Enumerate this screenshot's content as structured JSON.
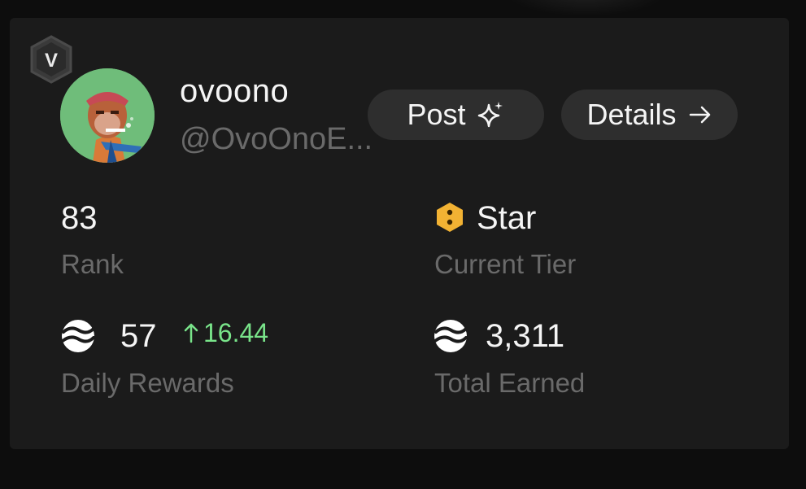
{
  "profile": {
    "badge_letter": "V",
    "username": "ovoono",
    "handle": "@OvoOnoE..."
  },
  "actions": {
    "post_label": "Post",
    "details_label": "Details"
  },
  "stats": {
    "rank": {
      "value": "83",
      "label": "Rank"
    },
    "tier": {
      "value": "Star",
      "label": "Current Tier"
    },
    "daily": {
      "value": "57",
      "delta": "16.44",
      "label": "Daily Rewards"
    },
    "total": {
      "value": "3,311",
      "label": "Total Earned"
    }
  },
  "icons": {
    "badge": "verified-v-hexagon-icon",
    "post": "sparkles-icon",
    "details": "arrow-right-icon",
    "tier": "hexagon-tier-icon",
    "coin": "token-coin-icon",
    "delta": "arrow-up-icon"
  },
  "colors": {
    "background": "#0d0d0d",
    "card": "#1b1b1b",
    "pill": "#2e2e2e",
    "muted": "#6a6a6a",
    "positive": "#79e48a",
    "tier": "#f2b233"
  }
}
